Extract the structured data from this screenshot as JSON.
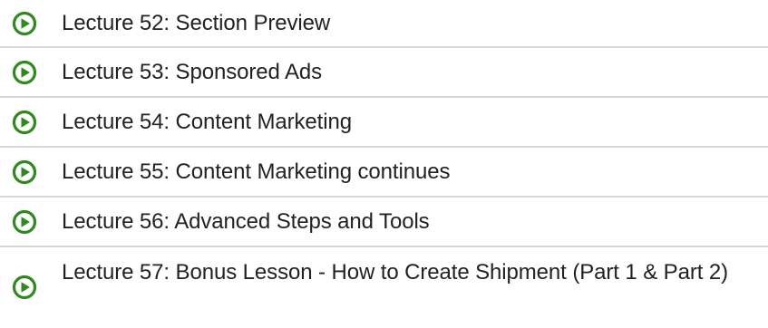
{
  "accent_color": "#2f8a1e",
  "lectures": [
    {
      "label": "Lecture 52: Section Preview",
      "icon": "play-circle-icon"
    },
    {
      "label": "Lecture 53: Sponsored Ads",
      "icon": "play-circle-icon"
    },
    {
      "label": "Lecture 54: Content Marketing",
      "icon": "play-circle-icon"
    },
    {
      "label": "Lecture 55: Content Marketing continues",
      "icon": "play-circle-icon"
    },
    {
      "label": "Lecture 56: Advanced Steps and Tools",
      "icon": "play-circle-icon"
    },
    {
      "label": "Lecture 57: Bonus Lesson - How to Create Shipment (Part 1 & Part 2)",
      "icon": "play-circle-icon"
    }
  ]
}
